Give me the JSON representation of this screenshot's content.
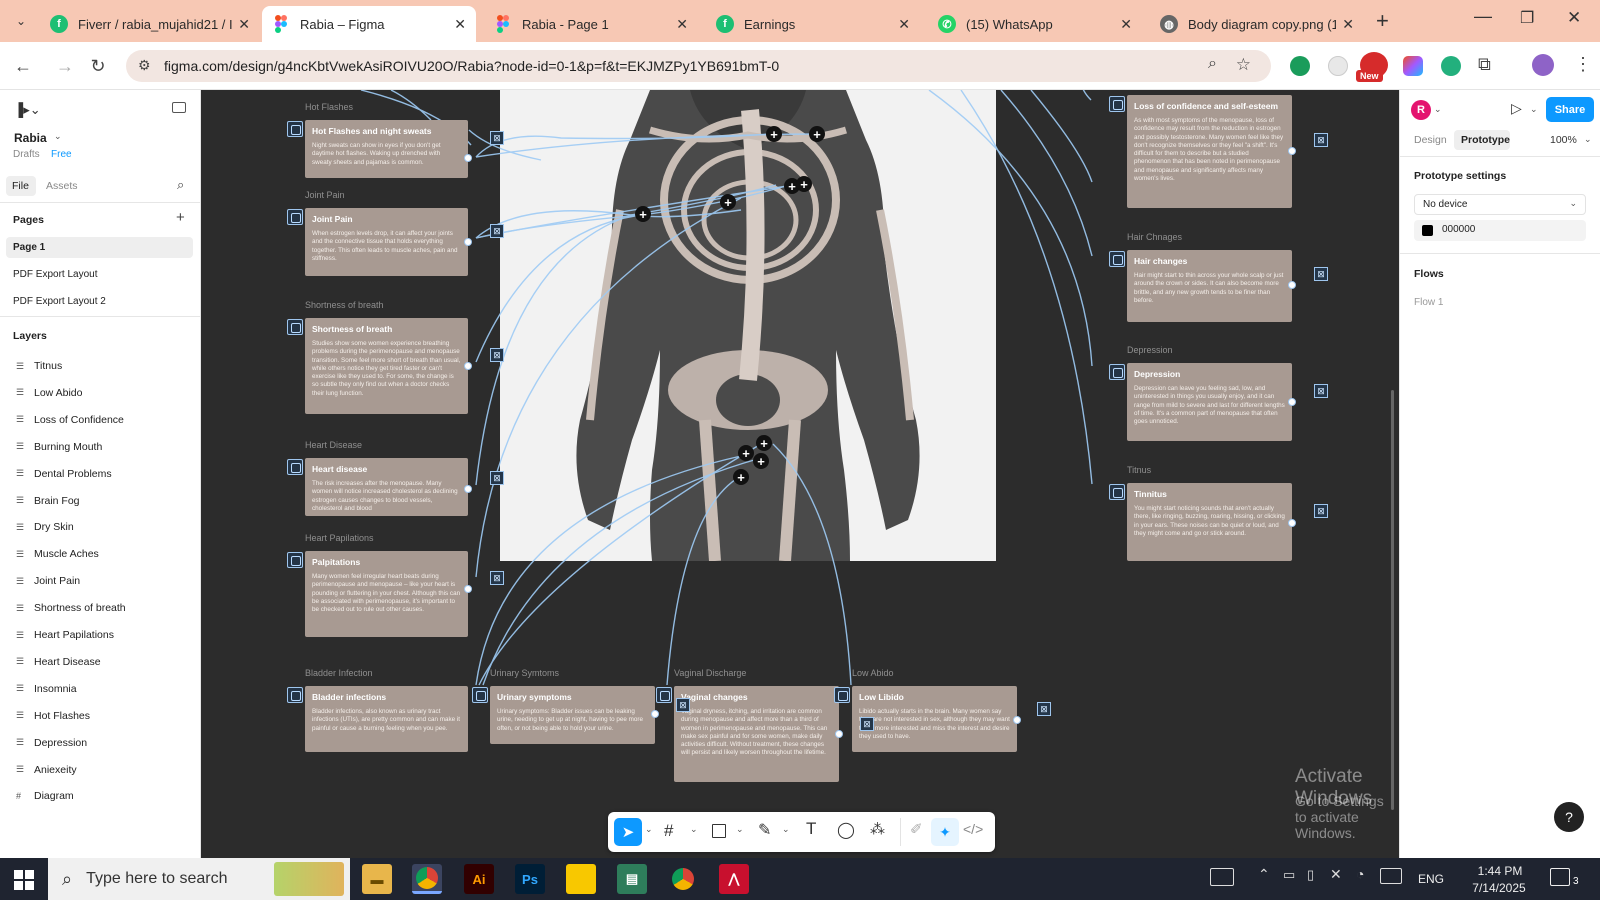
{
  "browser": {
    "tabs": [
      {
        "title": "Fiverr / rabia_mujahid21 / I",
        "icon": "fiverr-icon",
        "color": "#1dbf73"
      },
      {
        "title": "Rabia – Figma",
        "icon": "figma-icon",
        "color": "#f24e1e",
        "active": true
      },
      {
        "title": "Rabia - Page 1",
        "icon": "figma-icon",
        "color": "#f24e1e"
      },
      {
        "title": "Earnings",
        "icon": "fiverr-icon",
        "color": "#1dbf73"
      },
      {
        "title": "(15) WhatsApp",
        "icon": "whatsapp-icon",
        "color": "#25d366"
      },
      {
        "title": "Body diagram copy.png (1",
        "icon": "globe-icon",
        "color": "#555555"
      }
    ],
    "url": "figma.com/design/g4ncKbtVwekAsiROIVU20O/Rabia?node-id=0-1&p=f&t=EKJMZPy1YB691bmT-0",
    "new_badge": "New"
  },
  "left_panel": {
    "file_name": "Rabia",
    "drafts": "Drafts",
    "plan": "Free",
    "tab_file": "File",
    "tab_assets": "Assets",
    "pages_heading": "Pages",
    "pages": [
      "Page 1",
      "PDF Export Layout",
      "PDF Export Layout 2"
    ],
    "layers_heading": "Layers",
    "layers": [
      "Titnus",
      "Low Abido",
      "Loss of Confidence",
      "Burning Mouth",
      "Dental Problems",
      "Brain Fog",
      "Dry Skin",
      "Muscle Aches",
      "Joint Pain",
      "Shortness of breath",
      "Heart Papilations",
      "Heart Disease",
      "Insomnia",
      "Hot Flashes",
      "Depression",
      "Aniexeity",
      "Diagram"
    ]
  },
  "right_panel": {
    "avatar": "R",
    "share": "Share",
    "tab_design": "Design",
    "tab_prototype": "Prototype",
    "zoom": "100%",
    "prototype_settings": "Prototype settings",
    "device": "No device",
    "bg_color": "000000",
    "flows": "Flows",
    "flow1": "Flow 1"
  },
  "canvas": {
    "frames": [
      {
        "label": "Hot Flashes",
        "title": "Hot Flashes and night sweats",
        "body": "Night sweats can show in eyes if you don't get daytime hot flashes. Waking up drenched with sweaty sheets and pajamas is common."
      },
      {
        "label": "Joint Pain",
        "title": "Joint Pain",
        "body": "When estrogen levels drop, it can affect your joints and the connective tissue that holds everything together. This often leads to muscle aches, pain and stiffness."
      },
      {
        "label": "Shortness of breath",
        "title": "Shortness of breath",
        "body": "Studies show some women experience breathing problems during the perimenopause and menopause transition. Some feel more short of breath than usual, while others notice they get tired faster or can't exercise like they used to. For some, the change is so subtle they only find out when a doctor checks their lung function."
      },
      {
        "label": "Heart Disease",
        "title": "Heart disease",
        "body": "The risk increases after the menopause. Many women will notice increased cholesterol as declining estrogen causes changes to blood vessels, cholesterol and blood"
      },
      {
        "label": "Heart Papilations",
        "title": "Palpitations",
        "body": "Many women feel irregular heart beats during perimenopause and menopause – like your heart is pounding or fluttering in your chest. Although this can be associated with perimenopause, it's important to be checked out to rule out other causes."
      },
      {
        "label": "Bladder Infection",
        "title": "Bladder infections",
        "body": "Bladder infections, also known as urinary tract infections (UTIs), are pretty common and can make it painful or cause a burning feeling when you pee."
      },
      {
        "label": "Urinary Symtoms",
        "title": "Urinary symptoms",
        "body": "Urinary symptoms: Bladder issues can be leaking urine, needing to get up at night, having to pee more often, or not being able to hold your urine."
      },
      {
        "label": "Vaginal Discharge",
        "title": "Vaginal changes",
        "body": "Vaginal dryness, itching, and irritation are common during menopause and affect more than a third of women in perimenopause and menopause. This can make sex painful and for some women, make daily activities difficult. Without treatment, these changes will persist and likely worsen throughout the lifetime."
      },
      {
        "label": "Low Abido",
        "title": "Low Libido",
        "body": "Libido actually starts in the brain. Many women say they are not interested in sex, although they may want to be more interested and miss the interest and desire they used to have."
      },
      {
        "label": "",
        "title": "Loss of confidence and self-esteem",
        "body": "As with most symptoms of the menopause, loss of confidence may result from the reduction in estrogen and possibly testosterone. Many women feel like they don't recognize themselves or they feel \"a shift\". It's difficult for them to describe but a studied phenomenon that has been noted in perimenopause and menopause and significantly affects many women's lives."
      },
      {
        "label": "Hair Chnages",
        "title": "Hair changes",
        "body": "Hair might start to thin across your whole scalp or just around the crown or sides. It can also become more brittle, and any new growth tends to be finer than before."
      },
      {
        "label": "Depression",
        "title": "Depression",
        "body": "Depression can leave you feeling sad, low, and uninterested in things you usually enjoy, and it can range from mild to severe and last for different lengths of time. It's a common part of menopause that often goes unnoticed."
      },
      {
        "label": "Titnus",
        "title": "Tinnitus",
        "body": "You might start noticing sounds that aren't actually there, like ringing, buzzing, roaring, hissing, or clicking in your ears. These noises can be quiet or loud, and they might come and go or stick around."
      }
    ],
    "watermark_title": "Activate Windows",
    "watermark_sub": "Go to Settings to activate Windows."
  },
  "taskbar": {
    "search_placeholder": "Type here to search",
    "lang": "ENG",
    "time": "1:44 PM",
    "date": "7/14/2025",
    "notifications": "3"
  }
}
